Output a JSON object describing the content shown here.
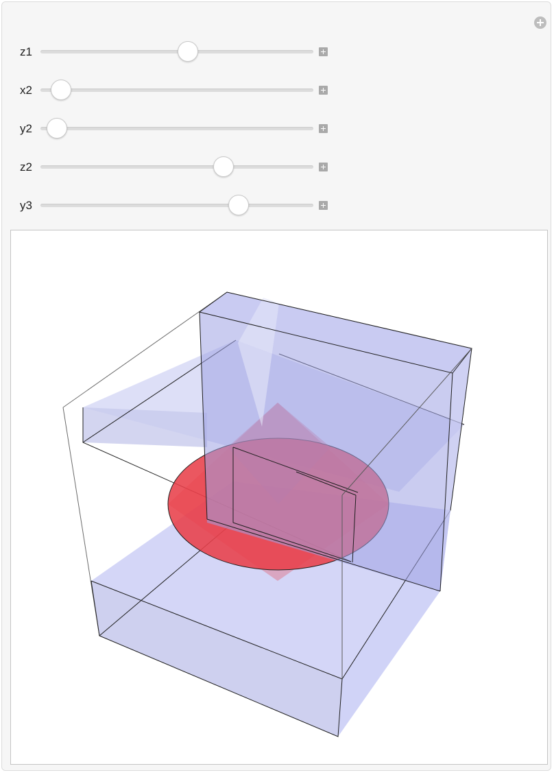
{
  "controls": [
    {
      "label": "z1",
      "value": 0.54
    },
    {
      "label": "x2",
      "value": 0.075
    },
    {
      "label": "y2",
      "value": 0.06
    },
    {
      "label": "z2",
      "value": 0.67
    },
    {
      "label": "y3",
      "value": 0.725
    }
  ],
  "colors": {
    "panel": "#f6f6f6",
    "slab": "#b3b7ef",
    "disk": "#e8404a",
    "edge": "#1a1a1a"
  },
  "icons": {
    "corner": "circle-plus-icon",
    "stepper": "plus-square-icon"
  }
}
